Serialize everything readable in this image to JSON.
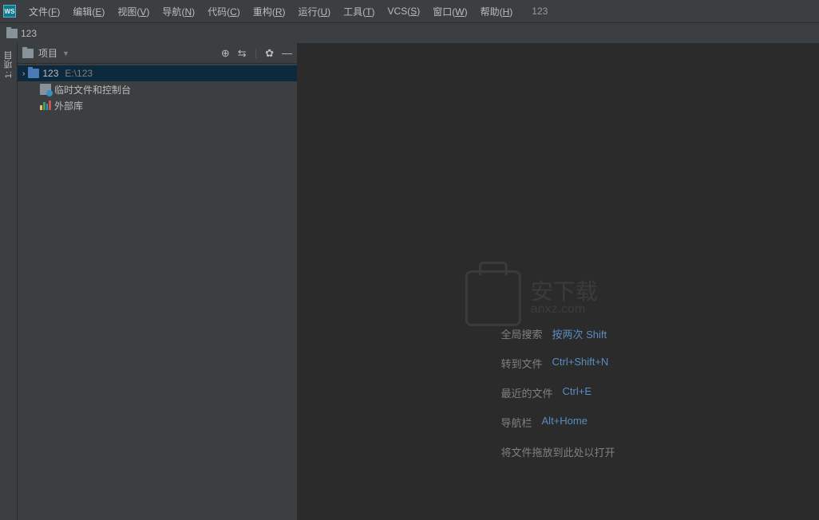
{
  "app_icon_text": "WS",
  "menubar": [
    {
      "label": "文件",
      "key": "F"
    },
    {
      "label": "编辑",
      "key": "E"
    },
    {
      "label": "视图",
      "key": "V"
    },
    {
      "label": "导航",
      "key": "N"
    },
    {
      "label": "代码",
      "key": "C"
    },
    {
      "label": "重构",
      "key": "R"
    },
    {
      "label": "运行",
      "key": "U"
    },
    {
      "label": "工具",
      "key": "T"
    },
    {
      "label": "VCS",
      "key": "S"
    },
    {
      "label": "窗口",
      "key": "W"
    },
    {
      "label": "帮助",
      "key": "H"
    }
  ],
  "title_extra": "123",
  "breadcrumb": {
    "name": "123"
  },
  "left_tab": "1: 项目",
  "sidebar": {
    "title": "项目",
    "tree": [
      {
        "type": "project",
        "name": "123",
        "path": "E:\\123",
        "selected": true
      },
      {
        "type": "scratch",
        "name": "临时文件和控制台"
      },
      {
        "type": "lib",
        "name": "外部库"
      }
    ]
  },
  "watermark": {
    "main": "安下载",
    "sub": "anxz.com"
  },
  "shortcuts": [
    {
      "label": "全局搜索",
      "key": "按两次 Shift"
    },
    {
      "label": "转到文件",
      "key": "Ctrl+Shift+N"
    },
    {
      "label": "最近的文件",
      "key": "Ctrl+E"
    },
    {
      "label": "导航栏",
      "key": "Alt+Home"
    }
  ],
  "drop_hint": "将文件拖放到此处以打开"
}
